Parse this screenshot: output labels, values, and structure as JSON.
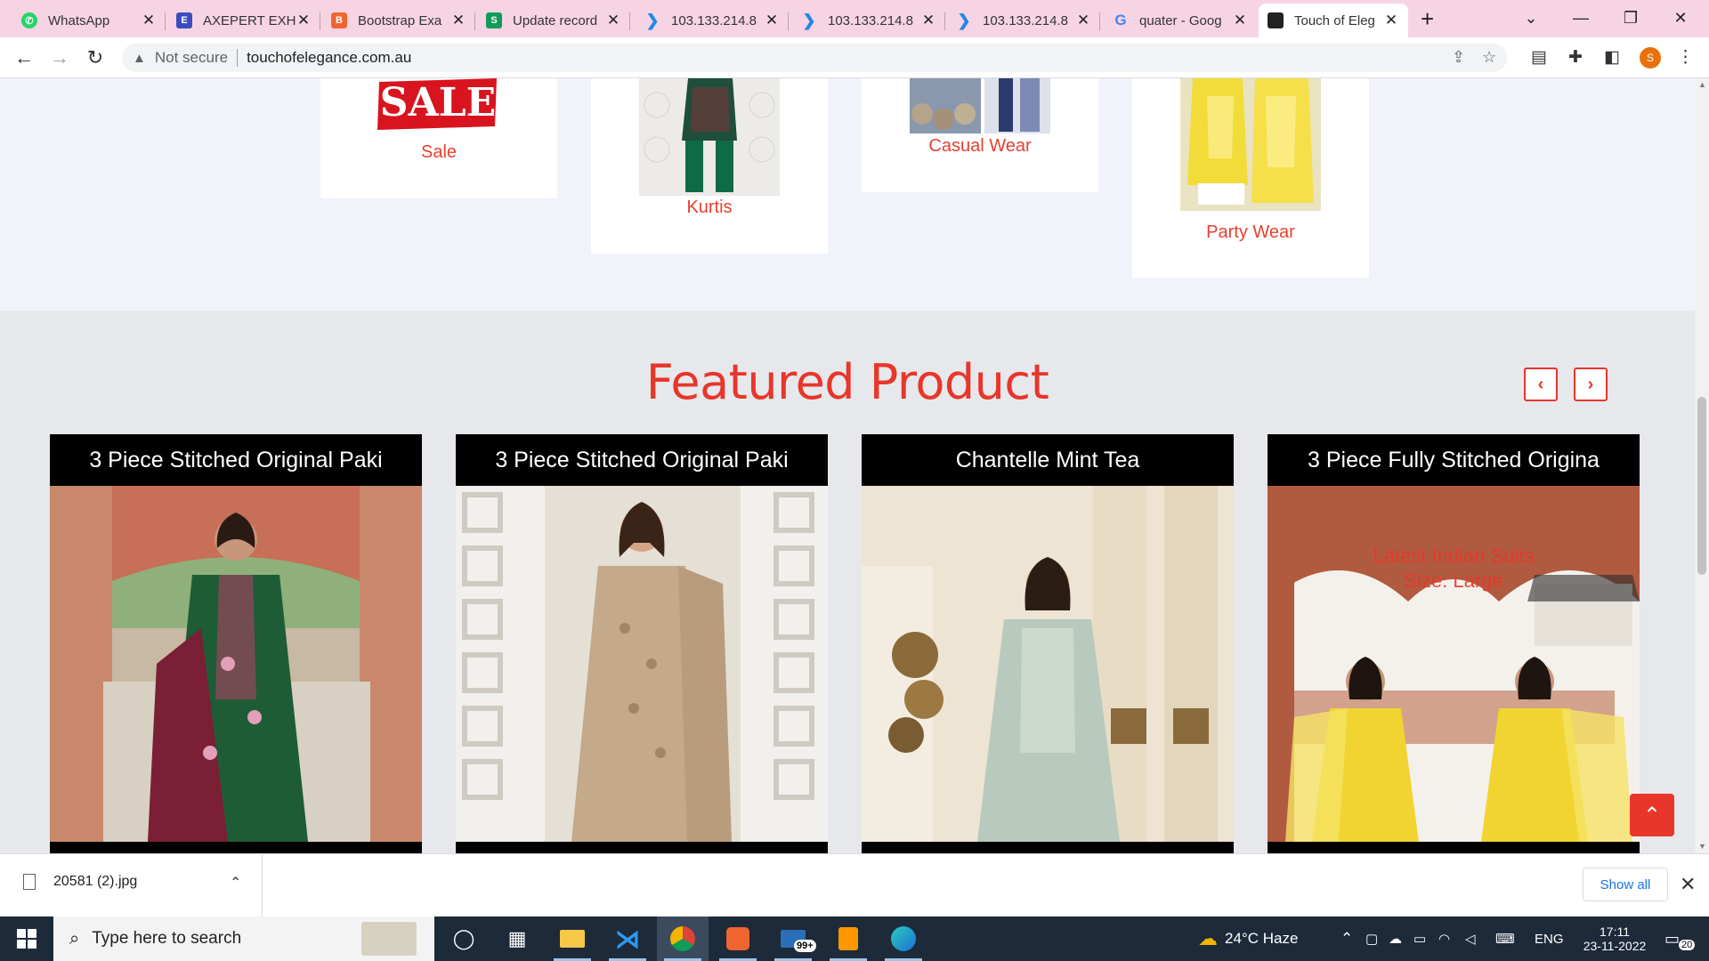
{
  "browser": {
    "tabs": [
      {
        "label": "WhatsApp",
        "icon": "whatsapp-icon",
        "color": "#25d366"
      },
      {
        "label": "AXEPERT EXHI",
        "icon": "axepert-icon",
        "color": "#3b4cc0"
      },
      {
        "label": "Bootstrap Exa",
        "icon": "bootstrap-icon",
        "color": "#f0652f"
      },
      {
        "label": "Update record",
        "icon": "sheets-icon",
        "color": "#0f9d58"
      },
      {
        "label": "103.133.214.8",
        "icon": "remote-icon",
        "color": "#1e88e5"
      },
      {
        "label": "103.133.214.8",
        "icon": "remote-icon",
        "color": "#1e88e5"
      },
      {
        "label": "103.133.214.8",
        "icon": "remote-icon",
        "color": "#1e88e5"
      },
      {
        "label": "quater - Goog",
        "icon": "google-icon",
        "color": "#4285f4"
      },
      {
        "label": "Touch of Eleg",
        "icon": "site-icon",
        "color": "#222222"
      }
    ],
    "new_tab": "+",
    "tab_list": "⌄",
    "minimize": "—",
    "restore": "❐",
    "close": "✕",
    "back": "←",
    "forward": "→",
    "reload": "↻",
    "security_icon": "▲",
    "security_text": "Not secure",
    "url": "touchofelegance.com.au",
    "share": "⇪",
    "star": "☆",
    "reading_list": "▤",
    "extensions": "✚",
    "sidepanel": "◧",
    "profile_initial": "S",
    "menu": "⋮"
  },
  "categories": [
    {
      "label": "Sale",
      "badge": "SALE"
    },
    {
      "label": "Kurtis"
    },
    {
      "label": "Casual Wear"
    },
    {
      "label": "Party Wear"
    }
  ],
  "featured": {
    "title": "Featured Product",
    "prev": "‹",
    "next": "›",
    "products": [
      {
        "title": "3 Piece Stitched Original Paki"
      },
      {
        "title": "3 Piece Stitched Original Paki"
      },
      {
        "title": "Chantelle Mint Tea"
      },
      {
        "title": "3 Piece Fully Stitched Origina",
        "overlay_line1": "Latest Indian Suits",
        "overlay_line2": "Size: Large"
      }
    ],
    "scroll_top": "⌃"
  },
  "downloads": {
    "file": "20581 (2).jpg",
    "caret": "⌃",
    "show_all": "Show all",
    "close": "✕"
  },
  "taskbar": {
    "start": "⊞",
    "search_placeholder": "Type here to search",
    "task_view": "◯",
    "widgets": "▦",
    "weather": "24°C  Haze",
    "chevron": "⌃",
    "language": "ENG",
    "time": "17:11",
    "date": "23-11-2022",
    "mail_badge": "99+",
    "notif_count": "20"
  },
  "colors": {
    "accent": "#e8362a",
    "tab_strip": "#f7d4e4",
    "taskbar": "#1c2a3a"
  }
}
